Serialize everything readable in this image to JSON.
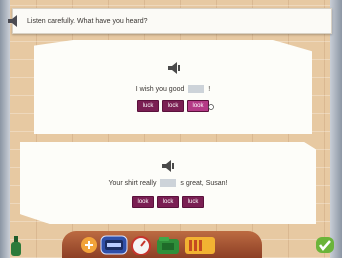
{
  "instruction": {
    "text": "Listen carefully. What have you heard?"
  },
  "questions": [
    {
      "before": "I wish you good",
      "after": "!",
      "options": [
        "luck",
        "lock",
        "look"
      ]
    },
    {
      "before": "Your shirt really",
      "after": "s great, Susan!",
      "options": [
        "look",
        "lock",
        "luck"
      ]
    }
  ],
  "toolbar": {
    "icons": [
      "bottle-icon",
      "tools-icon",
      "clock-icon",
      "gauge-icon",
      "folder-icon",
      "book-icon",
      "check-icon"
    ]
  },
  "colors": {
    "option": "#7a1f53",
    "option_highlight": "#b43a86",
    "blank": "#cdd3d9",
    "wall": "#e7c9a2"
  }
}
